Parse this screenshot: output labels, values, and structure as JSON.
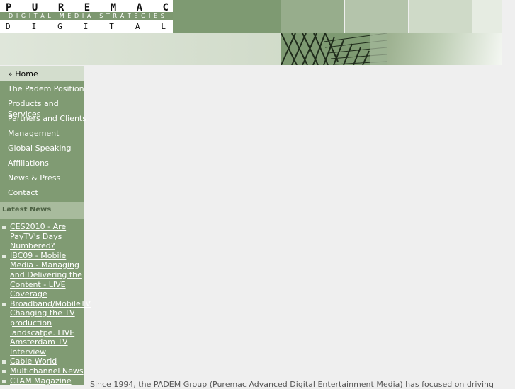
{
  "logo": {
    "top_letters": [
      "P",
      "U",
      "R",
      "E",
      "M",
      "A",
      "C"
    ],
    "band_text": "DIGITAL MEDIA STRATEGIES",
    "bottom_letters": [
      "D",
      "I",
      "G",
      "I",
      "T",
      "A",
      "L"
    ]
  },
  "nav": {
    "home": "Home",
    "items": [
      "The Padem Position",
      "Products and Services",
      "Partners and Clients",
      "Management",
      "Global Speaking",
      "Affiliations",
      "News & Press",
      "Contact"
    ]
  },
  "latest_news": {
    "heading": "Latest News",
    "items": [
      "CES2010 - Are PayTV's Days Numbered?",
      "IBC09 - Mobile Media - Managing and Delivering the Content - LIVE Coverage",
      "Broadband/MobileTV Changing the TV production landscatpe. LIVE Amsterdam TV Interview",
      "Cable World",
      "Multichannel News",
      "CTAM Magazine"
    ]
  },
  "intro_text": "Since 1994, the PADEM Group (Puremac Advanced Digital Entertainment Media) has focused on driving"
}
